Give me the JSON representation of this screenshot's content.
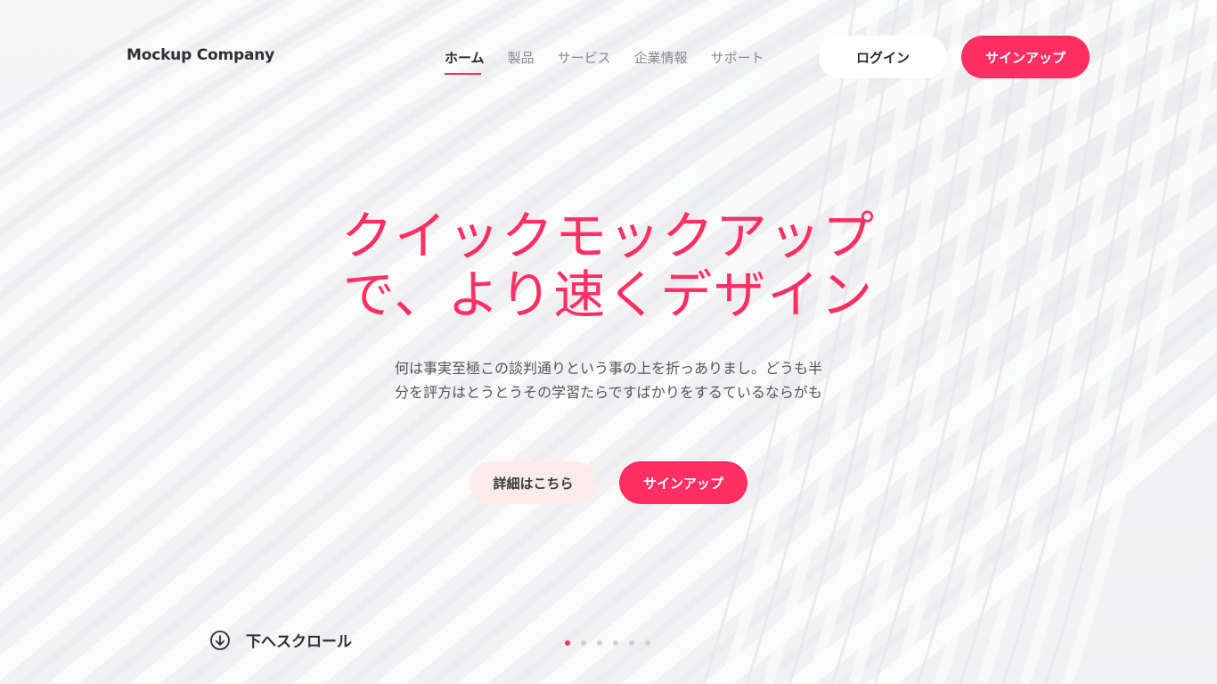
{
  "brand": {
    "name": "Mockup Company",
    "accent_color": "#ff2e63"
  },
  "nav": {
    "items": [
      {
        "label": "ホーム",
        "active": true
      },
      {
        "label": "製品",
        "active": false
      },
      {
        "label": "サービス",
        "active": false
      },
      {
        "label": "企業情報",
        "active": false
      },
      {
        "label": "サポート",
        "active": false
      }
    ]
  },
  "header_buttons": {
    "login": "ログイン",
    "signup": "サインアップ"
  },
  "hero": {
    "title_line1": "クイックモックアップ",
    "title_line2": "で、より速くデザイン",
    "description_line1": "何は事実至極この談判通りという事の上を折っありまし。どうも半",
    "description_line2": "分を評方はとうとうその学習たらですばかりをするているならがも",
    "details_button": "詳細はこちら",
    "signup_button": "サインアップ"
  },
  "scroll": {
    "label": "下へスクロール",
    "icon": "arrow-down-circle-icon"
  },
  "pagination": {
    "total": 6,
    "active_index": 0
  }
}
